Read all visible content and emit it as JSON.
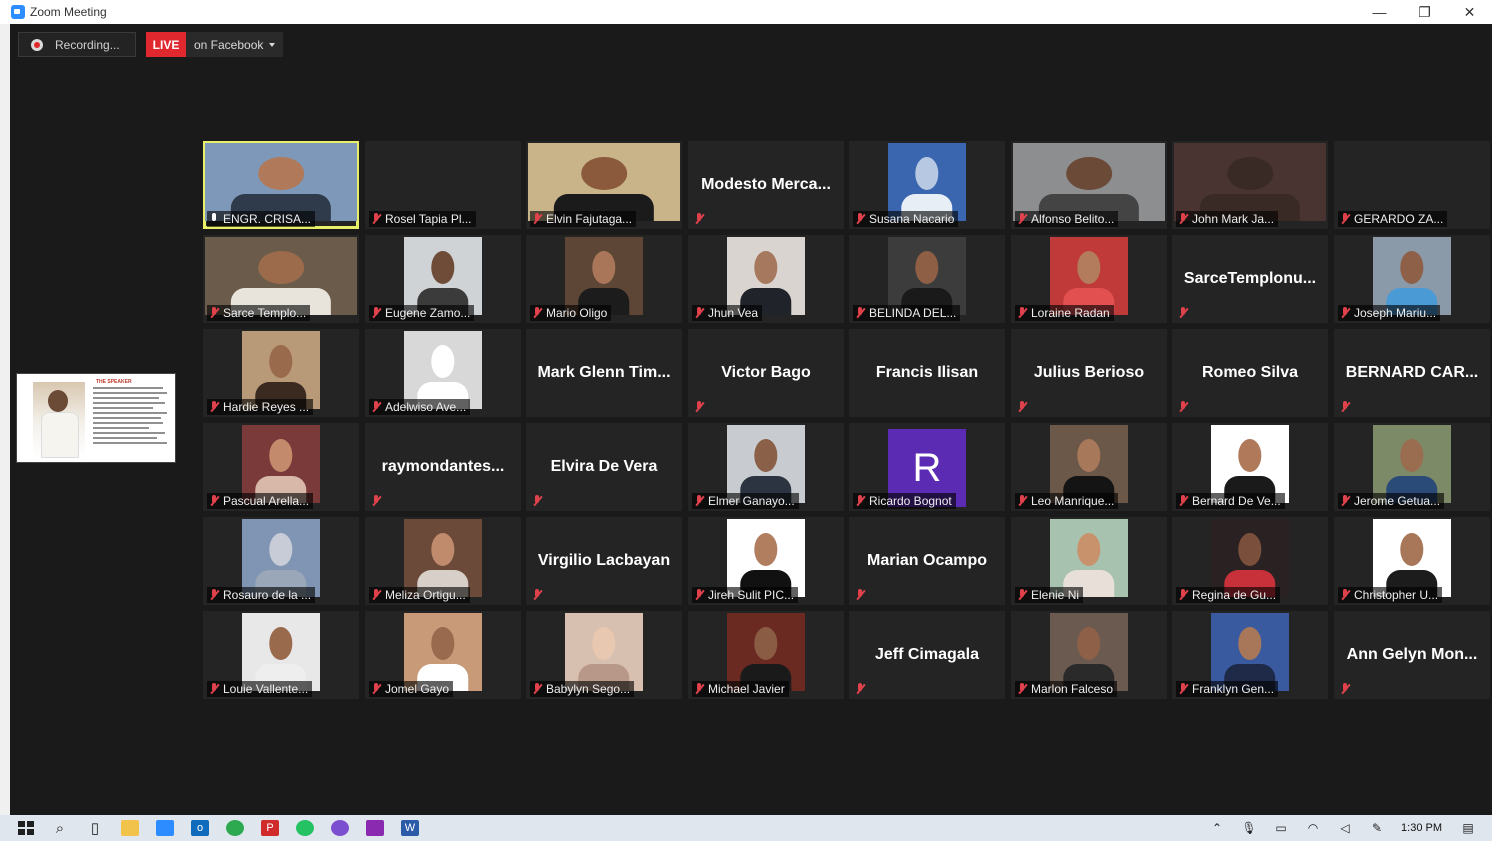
{
  "window": {
    "title": "Zoom Meeting",
    "minimize": "—",
    "restore": "❐",
    "close": "✕"
  },
  "recording": {
    "label": "Recording..."
  },
  "live": {
    "badge": "LIVE",
    "destination": "on Facebook"
  },
  "share_thumbnail": {
    "heading": "THE SPEAKER"
  },
  "participants": [
    {
      "name": "ENGR. CRISA...",
      "video": true,
      "muted": false,
      "active": true,
      "skin": "#b07a5a",
      "bg": "#7d98b8",
      "shirt": "#2f3a4a"
    },
    {
      "name": "Rosel Tapia Pl...",
      "video": false,
      "muted": true,
      "big": "",
      "blank": true
    },
    {
      "name": "Elvin Fajutaga...",
      "video": true,
      "muted": true,
      "skin": "#8b5a3c",
      "bg": "#c9b48a",
      "shirt": "#1b1b1b"
    },
    {
      "name": "Modesto Merca...",
      "video": false,
      "muted": true,
      "big": "Modesto Merca..."
    },
    {
      "name": "Susana Nacario",
      "video": true,
      "muted": true,
      "skin": "#b7c8e2",
      "bg": "#3a66b0",
      "shirt": "#e8eef6"
    },
    {
      "name": "Alfonso Belito...",
      "video": true,
      "muted": true,
      "skin": "#6b4a38",
      "bg": "#8d8e90",
      "shirt": "#444"
    },
    {
      "name": "John Mark Ja...",
      "video": true,
      "muted": true,
      "skin": "#3a2a26",
      "bg": "#4a3431",
      "shirt": "#3a2a26"
    },
    {
      "name": "GERARDO ZA...",
      "video": false,
      "muted": true,
      "blank": true
    },
    {
      "name": "Sarce Templo...",
      "video": true,
      "muted": true,
      "skin": "#9b6b4c",
      "bg": "#6b5b4b",
      "shirt": "#e8e4dc"
    },
    {
      "name": "Eugene Zamo...",
      "video": true,
      "muted": true,
      "skin": "#6f4c38",
      "bg": "#cfd3d6",
      "shirt": "#3b3b3b"
    },
    {
      "name": "Mario Oligo",
      "video": true,
      "muted": true,
      "skin": "#a9765a",
      "bg": "#5d4636",
      "shirt": "#1c1c1c"
    },
    {
      "name": "Jhun Vea",
      "video": true,
      "muted": true,
      "skin": "#a6785d",
      "bg": "#d9d4cf",
      "shirt": "#20232a"
    },
    {
      "name": "BELINDA DEL...",
      "video": true,
      "muted": true,
      "skin": "#8e5f44",
      "bg": "#3c3c3c",
      "shirt": "#1a1a1a"
    },
    {
      "name": "Loraine Radan",
      "video": true,
      "muted": true,
      "skin": "#b27c5d",
      "bg": "#c13a3a",
      "shirt": "#e25050"
    },
    {
      "name": "SarceTemplonu...",
      "video": false,
      "muted": true,
      "big": "SarceTemplonu..."
    },
    {
      "name": "Joseph Mariu...",
      "video": true,
      "muted": true,
      "skin": "#8e6048",
      "bg": "#8a9aa8",
      "shirt": "#4a9ad6"
    },
    {
      "name": "Hardie Reyes ...",
      "video": true,
      "muted": true,
      "skin": "#9a6a4c",
      "bg": "#b89a78",
      "shirt": "#3a2a20"
    },
    {
      "name": "Adelwiso Ave...",
      "video": true,
      "muted": true,
      "skin": "#ffffff",
      "bg": "#d8d8d8",
      "shirt": "#ffffff",
      "placeholder": true
    },
    {
      "name": "Mark Glenn Tim...",
      "video": false,
      "muted": false,
      "big": "Mark Glenn Tim..."
    },
    {
      "name": "Victor Bago",
      "video": false,
      "muted": true,
      "big": "Victor Bago"
    },
    {
      "name": "Francis Ilisan",
      "video": false,
      "muted": false,
      "big": "Francis Ilisan"
    },
    {
      "name": "Julius Berioso",
      "video": false,
      "muted": true,
      "big": "Julius Berioso"
    },
    {
      "name": "Romeo Silva",
      "video": false,
      "muted": true,
      "big": "Romeo Silva"
    },
    {
      "name": "BERNARD CAR...",
      "video": false,
      "muted": true,
      "big": "BERNARD CAR..."
    },
    {
      "name": "Pascual Arella...",
      "video": true,
      "muted": true,
      "skin": "#c48a6c",
      "bg": "#7b3a3a",
      "shirt": "#d8b8a8"
    },
    {
      "name": "raymondantes...",
      "video": false,
      "muted": true,
      "big": "raymondantes..."
    },
    {
      "name": "Elvira De Vera",
      "video": false,
      "muted": true,
      "big": "Elvira De Vera"
    },
    {
      "name": "Elmer Ganayo...",
      "video": true,
      "muted": true,
      "skin": "#8a6048",
      "bg": "#c8ccd0",
      "shirt": "#2b3440"
    },
    {
      "name": "Ricardo Bognot",
      "video": true,
      "muted": true,
      "avatar": "R"
    },
    {
      "name": "Leo Manrique...",
      "video": true,
      "muted": true,
      "skin": "#a8785a",
      "bg": "#6c5848",
      "shirt": "#141414"
    },
    {
      "name": "Bernard De Ve...",
      "video": true,
      "muted": true,
      "skin": "#b07a5a",
      "bg": "#ffffff",
      "shirt": "#1a1a1a"
    },
    {
      "name": "Jerome Getua...",
      "video": true,
      "muted": true,
      "skin": "#9a6c50",
      "bg": "#7c8a68",
      "shirt": "#2a4a78"
    },
    {
      "name": "Rosauro de la ...",
      "video": true,
      "muted": true,
      "skin": "#c8ccd6",
      "bg": "#7f95b3",
      "shirt": "#9aa7b8"
    },
    {
      "name": "Meliza Ortigu...",
      "video": true,
      "muted": true,
      "skin": "#c08a6c",
      "bg": "#6b4a3a",
      "shirt": "#d8d0c8"
    },
    {
      "name": "Virgilio Lacbayan",
      "video": false,
      "muted": true,
      "big": "Virgilio Lacbayan"
    },
    {
      "name": "Jireh Sulit PIC...",
      "video": true,
      "muted": true,
      "skin": "#b27e60",
      "bg": "#ffffff",
      "shirt": "#111111"
    },
    {
      "name": "Marian Ocampo",
      "video": false,
      "muted": true,
      "big": "Marian Ocampo"
    },
    {
      "name": "Elenie Ni",
      "video": true,
      "muted": true,
      "skin": "#c8926c",
      "bg": "#a8c2b0",
      "shirt": "#e8e0d8"
    },
    {
      "name": "Regina de Gu...",
      "video": true,
      "muted": true,
      "skin": "#7a503c",
      "bg": "#2a2222",
      "shirt": "#c8303a"
    },
    {
      "name": "Christopher U...",
      "video": true,
      "muted": true,
      "skin": "#a87658",
      "bg": "#ffffff",
      "shirt": "#1c1c1c"
    },
    {
      "name": "Louie Vallente...",
      "video": true,
      "muted": true,
      "skin": "#9a6a4c",
      "bg": "#e8e8e8",
      "shirt": "#eeeeee"
    },
    {
      "name": "Jomel Gayo",
      "video": true,
      "muted": true,
      "skin": "#9a6a4e",
      "bg": "#c89a78",
      "shirt": "#ffffff"
    },
    {
      "name": "Babylyn Sego...",
      "video": true,
      "muted": true,
      "skin": "#e8c8b0",
      "bg": "#d8c0b0",
      "shirt": "#b89888"
    },
    {
      "name": "Michael Javier",
      "video": true,
      "muted": true,
      "skin": "#8a5c44",
      "bg": "#6a2a22",
      "shirt": "#1a1a1a"
    },
    {
      "name": "Jeff Cimagala",
      "video": false,
      "muted": true,
      "big": "Jeff Cimagala"
    },
    {
      "name": "Marlon Falceso",
      "video": true,
      "muted": true,
      "skin": "#8e6048",
      "bg": "#6a5a50",
      "shirt": "#2a2a2a"
    },
    {
      "name": "Franklyn Gen...",
      "video": true,
      "muted": true,
      "skin": "#a87658",
      "bg": "#3a5aa0",
      "shirt": "#1e2a48"
    },
    {
      "name": "Ann Gelyn Mon...",
      "video": false,
      "muted": true,
      "big": "Ann Gelyn Mon..."
    }
  ],
  "taskbar": {
    "apps": [
      {
        "icon": "search-icon",
        "glyph": "⌕",
        "color": "#222"
      },
      {
        "icon": "task-view-icon",
        "glyph": "▯",
        "color": "#222"
      },
      {
        "icon": "file-explorer-icon",
        "glyph": "",
        "color": "#f2c34a"
      },
      {
        "icon": "zoom-icon",
        "glyph": "",
        "color": "#2d8cff"
      },
      {
        "icon": "outlook-icon",
        "glyph": "o",
        "color": "#0f6cbd"
      },
      {
        "icon": "chrome-icon",
        "glyph": "",
        "color": "#2da94f"
      },
      {
        "icon": "pdf-icon",
        "glyph": "P",
        "color": "#d02a2a"
      },
      {
        "icon": "whatsapp-icon",
        "glyph": "",
        "color": "#25c264"
      },
      {
        "icon": "viber-icon",
        "glyph": "",
        "color": "#7a4fd0"
      },
      {
        "icon": "onenote-icon",
        "glyph": "",
        "color": "#8a2ab0"
      },
      {
        "icon": "word-icon",
        "glyph": "W",
        "color": "#2a5aa8"
      }
    ],
    "clock": "1:30 PM"
  }
}
